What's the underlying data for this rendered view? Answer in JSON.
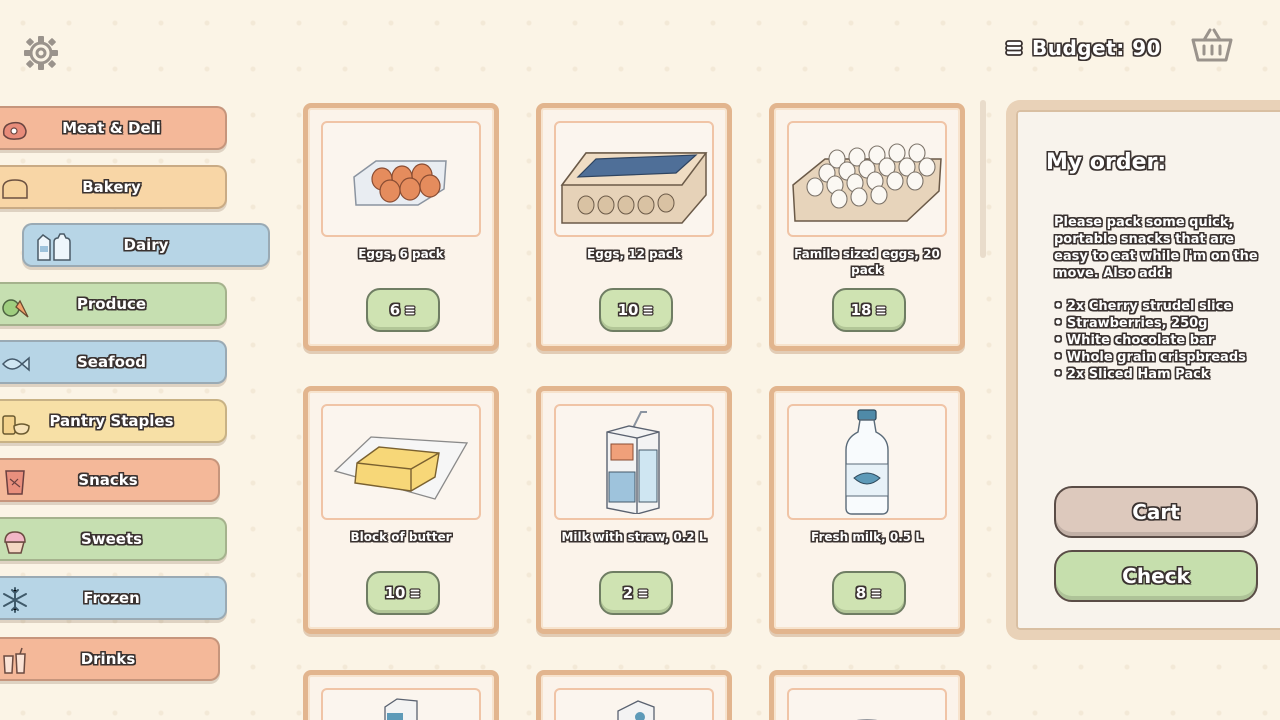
{
  "header": {
    "budget_label": "Budget: 90",
    "icons": [
      "gear-icon",
      "coin-stack-icon",
      "basket-icon"
    ]
  },
  "categories": [
    {
      "label": "Meat & Deli",
      "color": "#f4b899",
      "icon": "meat-icon"
    },
    {
      "label": "Bakery",
      "color": "#f8d6a6",
      "icon": "bread-icon"
    },
    {
      "label": "Dairy",
      "color": "#b7d5e6",
      "icon": "milk-icon",
      "active": true
    },
    {
      "label": "Produce",
      "color": "#c6dfb1",
      "icon": "apple-carrot-icon"
    },
    {
      "label": "Seafood",
      "color": "#b7d5e6",
      "icon": "fish-icon"
    },
    {
      "label": "Pantry Staples",
      "color": "#f7e0a6",
      "icon": "pantry-icon"
    },
    {
      "label": "Snacks",
      "color": "#f4b899",
      "icon": "chips-icon"
    },
    {
      "label": "Sweets",
      "color": "#c6dfb1",
      "icon": "cupcake-icon"
    },
    {
      "label": "Frozen",
      "color": "#b7d5e6",
      "icon": "snowflake-icon"
    },
    {
      "label": "Drinks",
      "color": "#f4b899",
      "icon": "drinks-icon"
    }
  ],
  "products": [
    {
      "name": "Eggs, 6 pack",
      "price": "6",
      "icon": "egg-carton-6-icon"
    },
    {
      "name": "Eggs, 12 pack",
      "price": "10",
      "icon": "egg-carton-12-icon"
    },
    {
      "name": "Famile sized eggs, 20 pack",
      "price": "18",
      "icon": "egg-tray-icon"
    },
    {
      "name": "Block of butter",
      "price": "10",
      "icon": "butter-icon"
    },
    {
      "name": "Milk with straw, 0.2 L",
      "price": "2",
      "icon": "milk-carton-straw-icon"
    },
    {
      "name": "Fresh milk, 0.5 L",
      "price": "8",
      "icon": "milk-bottle-icon"
    }
  ],
  "order": {
    "title": "My order:",
    "text": "Please pack some quick, portable snacks that are easy to eat while I'm on the move. Also add:",
    "items": [
      "2x Cherry strudel slice",
      "Strawberries, 250g",
      "White chocolate bar",
      "Whole grain crispbreads",
      "2x Sliced Ham Pack"
    ],
    "cart_label": "Cart",
    "check_label": "Check"
  }
}
